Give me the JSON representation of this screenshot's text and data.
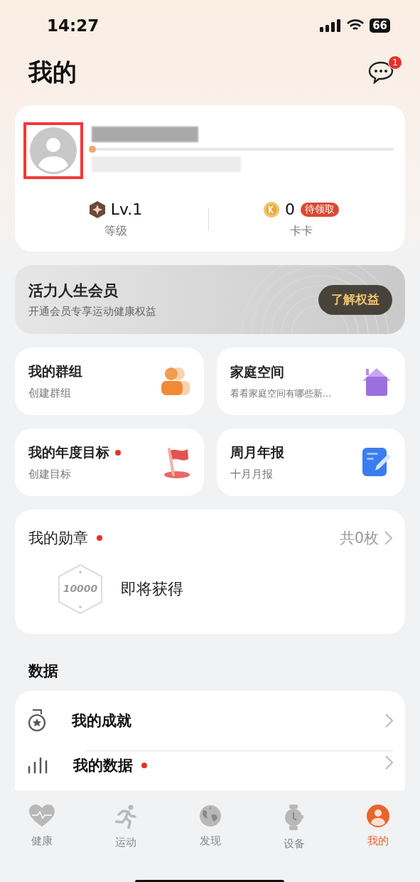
{
  "status_bar": {
    "time": "14:27",
    "battery": "66"
  },
  "header": {
    "title": "我的",
    "message_badge": "1"
  },
  "profile": {
    "avatar_highlighted": true,
    "level": "Lv.1",
    "level_label": "等级",
    "coins": "0",
    "coin_badge": "待领取",
    "coins_label": "卡卡"
  },
  "membership": {
    "title": "活力人生会员",
    "subtitle": "开通会员专享运动健康权益",
    "button": "了解权益"
  },
  "shortcuts": [
    {
      "title": "我的群组",
      "subtitle": "创建群组",
      "dot": false,
      "kind": "group"
    },
    {
      "title": "家庭空间",
      "subtitle": "看看家庭空间有哪些新…",
      "dot": false,
      "kind": "home"
    },
    {
      "title": "我的年度目标",
      "subtitle": "创建目标",
      "dot": true,
      "kind": "flag"
    },
    {
      "title": "周月年报",
      "subtitle": "十月月报",
      "dot": false,
      "kind": "report"
    }
  ],
  "medals": {
    "title": "我的勋章",
    "dot": true,
    "count": "共0枚",
    "badge_number": "10000",
    "badge_label": "即将获得"
  },
  "data_section": {
    "title": "数据",
    "items": [
      {
        "title": "我的成就",
        "dot": false,
        "kind": "achievement"
      },
      {
        "title": "我的数据",
        "dot": true,
        "kind": "data"
      }
    ]
  },
  "tab_bar": [
    {
      "label": "健康",
      "kind": "health",
      "selected": false
    },
    {
      "label": "运动",
      "kind": "sport",
      "selected": false
    },
    {
      "label": "发现",
      "kind": "discover",
      "selected": false
    },
    {
      "label": "设备",
      "kind": "device",
      "selected": false
    },
    {
      "label": "我的",
      "kind": "me",
      "selected": true
    }
  ]
}
